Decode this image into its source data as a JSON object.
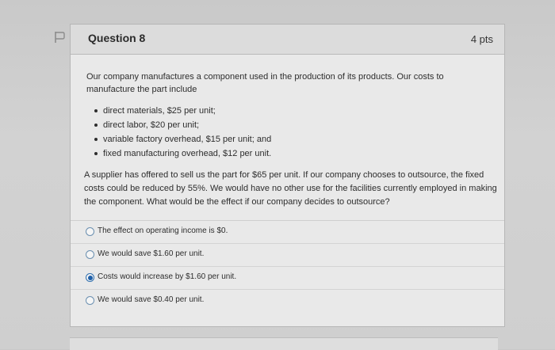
{
  "question": {
    "flag_icon": "flag-icon",
    "title": "Question 8",
    "points": "4 pts",
    "intro": "Our company manufactures a component used in the production of its products. Our costs to manufacture the part include",
    "cost_items": [
      "direct materials, $25 per unit;",
      "direct labor, $20 per unit;",
      "variable factory overhead, $15 per unit; and",
      "fixed manufacturing overhead, $12 per unit."
    ],
    "body": "A supplier has offered to sell us the part for $65 per unit. If our company chooses to outsource, the fixed costs could be reduced by 55%. We would have no other use for the facilities currently employed in making the component. What would be the effect if our company decides to outsource?",
    "answers": [
      {
        "label": "The effect on operating income is $0.",
        "selected": false
      },
      {
        "label": "We would save $1.60 per unit.",
        "selected": false
      },
      {
        "label": "Costs would increase by $1.60 per unit.",
        "selected": true
      },
      {
        "label": "We would save $0.40 per unit.",
        "selected": false
      }
    ]
  },
  "colors": {
    "radio_selected": "#1f5fa8",
    "card_background": "#e9e9e9"
  }
}
